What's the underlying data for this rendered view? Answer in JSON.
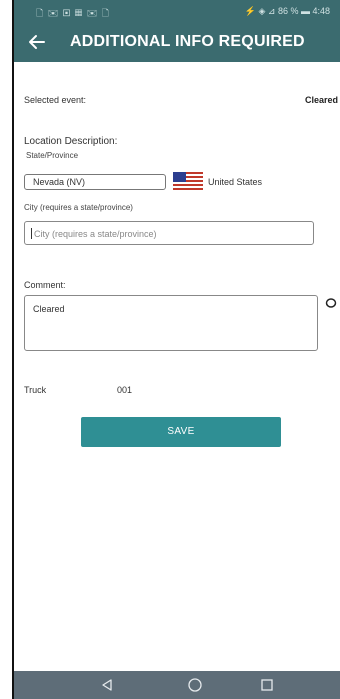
{
  "status_bar": {
    "left_icons": "🗋 ✉ ▣ ▦ ✉ 🗋",
    "right_text": "⚡ ◈ ⊿ 86 % ▬ 4:48"
  },
  "app_bar": {
    "title": "ADDITIONAL INFO REQUIRED",
    "back_icon": "arrow-left-icon"
  },
  "event": {
    "label": "Selected event:",
    "value": "Cleared"
  },
  "location": {
    "title": "Location Description:",
    "state_label": "State/Province",
    "state_value": "Nevada (NV)",
    "country": "United States",
    "city_label": "City (requires a state/province)",
    "city_placeholder": "City (requires a state/province)"
  },
  "comment": {
    "label": "Comment:",
    "value": "Cleared"
  },
  "truck": {
    "label": "Truck",
    "value": "001"
  },
  "save_label": "SAVE",
  "colors": {
    "app_bar": "#3b6b6f",
    "save_button": "#2f8f94",
    "nav_bar": "#5e6d78"
  }
}
